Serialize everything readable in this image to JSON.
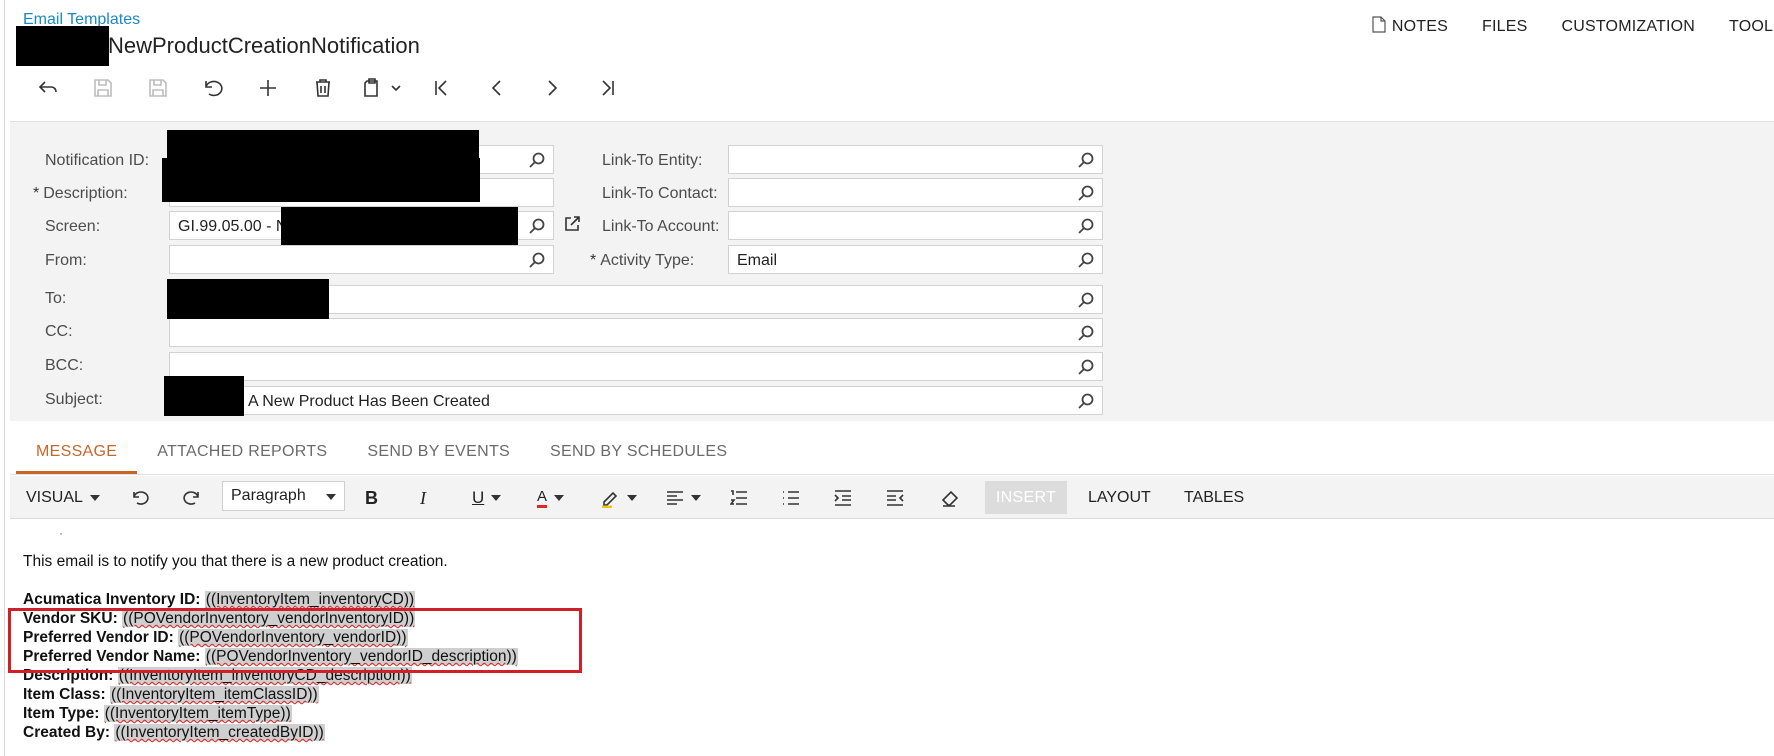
{
  "header": {
    "breadcrumb": "Email Templates",
    "title": "NewProductCreationNotification"
  },
  "top_menu": [
    {
      "label": "NOTES",
      "icon": "document-icon"
    },
    {
      "label": "FILES"
    },
    {
      "label": "CUSTOMIZATION"
    },
    {
      "label": "TOOLS"
    }
  ],
  "toolbar": {
    "icons": [
      "back-icon",
      "save-close-icon",
      "save-icon",
      "undo-icon",
      "add-icon",
      "delete-icon",
      "clipboard-icon",
      "first-record-icon",
      "previous-record-icon",
      "next-record-icon",
      "last-record-icon"
    ]
  },
  "form": {
    "notification_id": {
      "label": "Notification ID:",
      "value": ""
    },
    "description": {
      "label": "Description:",
      "required": true,
      "value": ""
    },
    "screen": {
      "label": "Screen:",
      "value": "GI.99.05.00 - N"
    },
    "from": {
      "label": "From:",
      "value": ""
    },
    "to": {
      "label": "To:",
      "value": ""
    },
    "cc": {
      "label": "CC:",
      "value": ""
    },
    "bcc": {
      "label": "BCC:",
      "value": ""
    },
    "subject": {
      "label": "Subject:",
      "value": "A New Product Has Been Created"
    },
    "link_to_entity": {
      "label": "Link-To Entity:",
      "value": ""
    },
    "link_to_contact": {
      "label": "Link-To Contact:",
      "value": ""
    },
    "link_to_account": {
      "label": "Link-To Account:",
      "value": ""
    },
    "activity_type": {
      "label": "Activity Type:",
      "required": true,
      "value": "Email"
    }
  },
  "tabs": [
    {
      "label": "MESSAGE",
      "active": true
    },
    {
      "label": "ATTACHED REPORTS",
      "active": false
    },
    {
      "label": "SEND BY EVENTS",
      "active": false
    },
    {
      "label": "SEND BY SCHEDULES",
      "active": false
    }
  ],
  "editor_toolbar": {
    "mode": "VISUAL",
    "paragraph": "Paragraph",
    "insert": "INSERT",
    "layout": "LAYOUT",
    "tables": "TABLES"
  },
  "editor": {
    "intro": "This email is to notify you that there is a new product creation.",
    "fields": [
      {
        "label": "Acumatica Inventory ID:",
        "token": "((InventoryItem_inventoryCD))"
      },
      {
        "label": "Vendor SKU:",
        "token": "((POVendorInventory_vendorInventoryID))"
      },
      {
        "label": "Preferred Vendor ID:",
        "token": "((POVendorInventory_vendorID))"
      },
      {
        "label": "Preferred Vendor Name:",
        "token": "((POVendorInventory_vendorID_description))"
      },
      {
        "label": "Description:",
        "token": "((InventoryItem_inventoryCD_description))"
      },
      {
        "label": "Item Class:",
        "token": "((InventoryItem_itemClassID))"
      },
      {
        "label": "Item Type:",
        "token": "((InventoryItem_itemType))"
      },
      {
        "label": "Created By:",
        "token": "((InventoryItem_createdByID))"
      }
    ],
    "highlight_color": "#d01f27"
  }
}
